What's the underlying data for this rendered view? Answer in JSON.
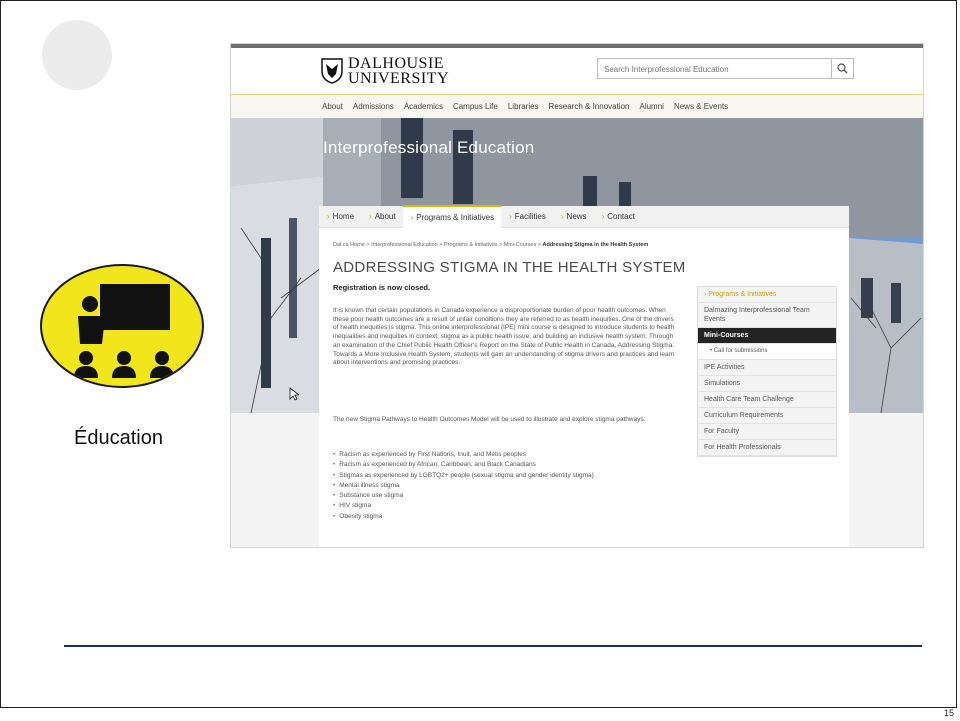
{
  "slide": {
    "label": "Éducation",
    "page_number": "15"
  },
  "site": {
    "logo": {
      "line1": "DALHOUSIE",
      "line2": "UNIVERSITY"
    },
    "search": {
      "placeholder": "Search Interprofessional Education",
      "icon": "search-icon"
    },
    "nav": [
      "About",
      "Admissions",
      "Academics",
      "Campus Life",
      "Libraries",
      "Research & Innovation",
      "Alumni",
      "News & Events"
    ],
    "hero_title": "Interprofessional Education",
    "subnav": [
      "Home",
      "About",
      "Programs & Initiatives",
      "Facilities",
      "News",
      "Contact"
    ],
    "subnav_active": "Programs & Initiatives",
    "breadcrumb": {
      "items": [
        "Dal.ca Home",
        "Interprofessional Education",
        "Programs & Initiatives",
        "Mini-Courses"
      ],
      "current": "Addressing Stigma in the Health System",
      "separator": ">"
    },
    "page_title": "ADDRESSING STIGMA IN THE HEALTH SYSTEM",
    "registration": "Registration is now closed.",
    "intro_paragraph": "It is known that certain populations in Canada experience a disproportionate burden of poor health outcomes. When these poor health outcomes are a result of unfair conditions they are referred to as health inequities. One of the drivers of health inequities is stigma. This online interprofessional (IPE) mini course is designed to introduce students to health inequalities and inequities in context, stigma as a public health issue, and building an inclusive health system. Through an examination of the Chief Public Health Officer's Report on the State of Public Health in Canada, Addressing Stigma: Towards a More Inclusive Health System, students will gain an understanding of stigma drivers and practices and learn about interventions and promising practices.",
    "model_paragraph": "The new Stigma Pathways to Health Outcomes Model will be used to illustrate and explore stigma pathways:",
    "bullets": [
      "Racism as experienced by First Nations, Inuit, and Métis peoples",
      "Racism as experienced by African, Caribbean, and Black Canadians",
      "Stigmas as experienced by LGBTQ2+ people (sexual stigma and gender identity stigma)",
      "Mental illness stigma",
      "Substance use stigma",
      "HIV stigma",
      "Obesity stigma"
    ],
    "sidebar": {
      "heading": "Programs & Initiatives",
      "items": [
        "Dalmazing Interprofessional Team Events",
        "Mini-Courses",
        "Call for submissions",
        "IPE Activities",
        "Simulations",
        "Health Care Team Challenge",
        "Curriculum Requirements",
        "For Faculty",
        "For Health Professionals"
      ],
      "selected": "Mini-Courses",
      "sub_item": "Call for submissions"
    }
  },
  "colors": {
    "icon_yellow": "#f1e51c",
    "accent_gold": "#e3b600",
    "rule_navy": "#1a2f5a",
    "selected_dark": "#242424"
  }
}
